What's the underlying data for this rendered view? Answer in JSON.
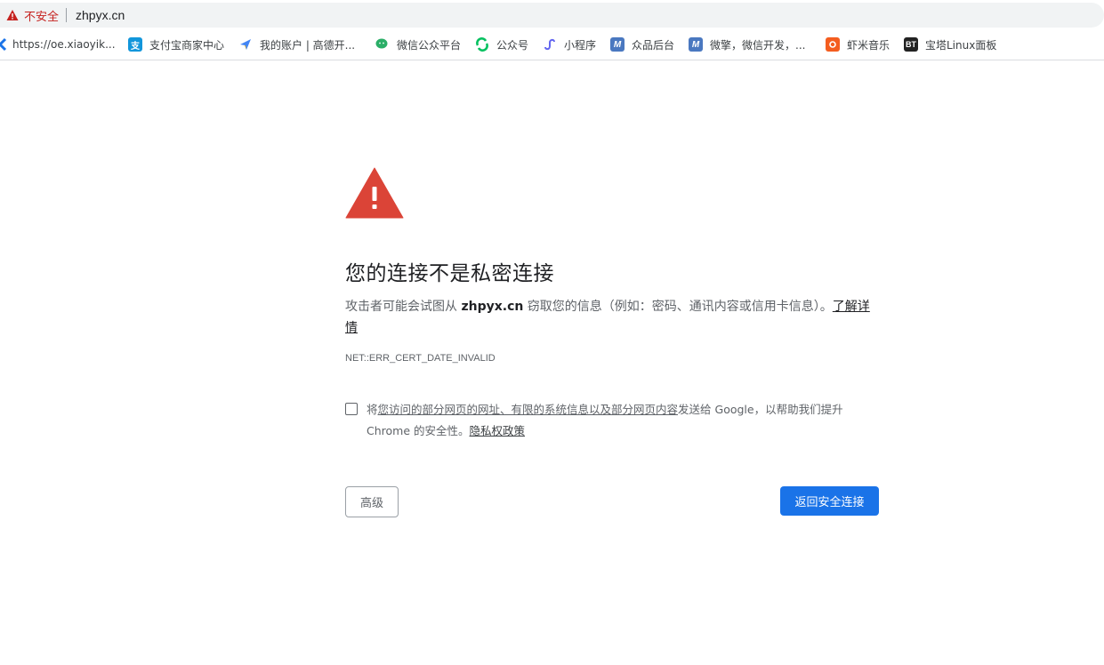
{
  "omnibox": {
    "security_label": "不安全",
    "url": "zhpyx.cn"
  },
  "bookmarks": [
    {
      "label": "https://oe.xiaoyik...",
      "icon": "blue-k-icon",
      "color": "#1a73e8"
    },
    {
      "label": "支付宝商家中心",
      "icon": "alipay-icon",
      "color": "#1296db"
    },
    {
      "label": "我的账户 | 高德开...",
      "icon": "amap-icon",
      "color": "#4285f4"
    },
    {
      "label": "微信公众平台",
      "icon": "wechat-icon",
      "color": "#2aae67"
    },
    {
      "label": "公众号",
      "icon": "refresh-green-icon",
      "color": "#07c160"
    },
    {
      "label": "小程序",
      "icon": "miniprogram-icon",
      "color": "#6467f0"
    },
    {
      "label": "众品后台",
      "icon": "m-logo-icon",
      "color": "#4a78c0"
    },
    {
      "label": "微擎，微信开发，...",
      "icon": "m-logo-icon",
      "color": "#4a78c0"
    },
    {
      "label": "虾米音乐",
      "icon": "xiami-icon",
      "color": "#f45d1f"
    },
    {
      "label": "宝塔Linux面板",
      "icon": "bt-icon",
      "color": "#222222",
      "text": "BT"
    }
  ],
  "interstitial": {
    "heading": "您的连接不是私密连接",
    "desc_prefix": "攻击者可能会试图从 ",
    "desc_host": "zhpyx.cn",
    "desc_suffix": " 窃取您的信息（例如：密码、通讯内容或信用卡信息）。",
    "learn_more": "了解详情",
    "error_code": "NET::ERR_CERT_DATE_INVALID",
    "optin_prefix": "将",
    "optin_link_text": "您访问的部分网页的网址、有限的系统信息以及部分网页内容",
    "optin_middle": "发送给 Google，以帮助我们提升 Chrome 的安全性。",
    "privacy_link": "隐私权政策",
    "advanced_button": "高级",
    "back_button": "返回安全连接"
  },
  "colors": {
    "warning_red": "#db4437",
    "primary_blue": "#1a73e8",
    "insecure_red": "#c5221f"
  }
}
